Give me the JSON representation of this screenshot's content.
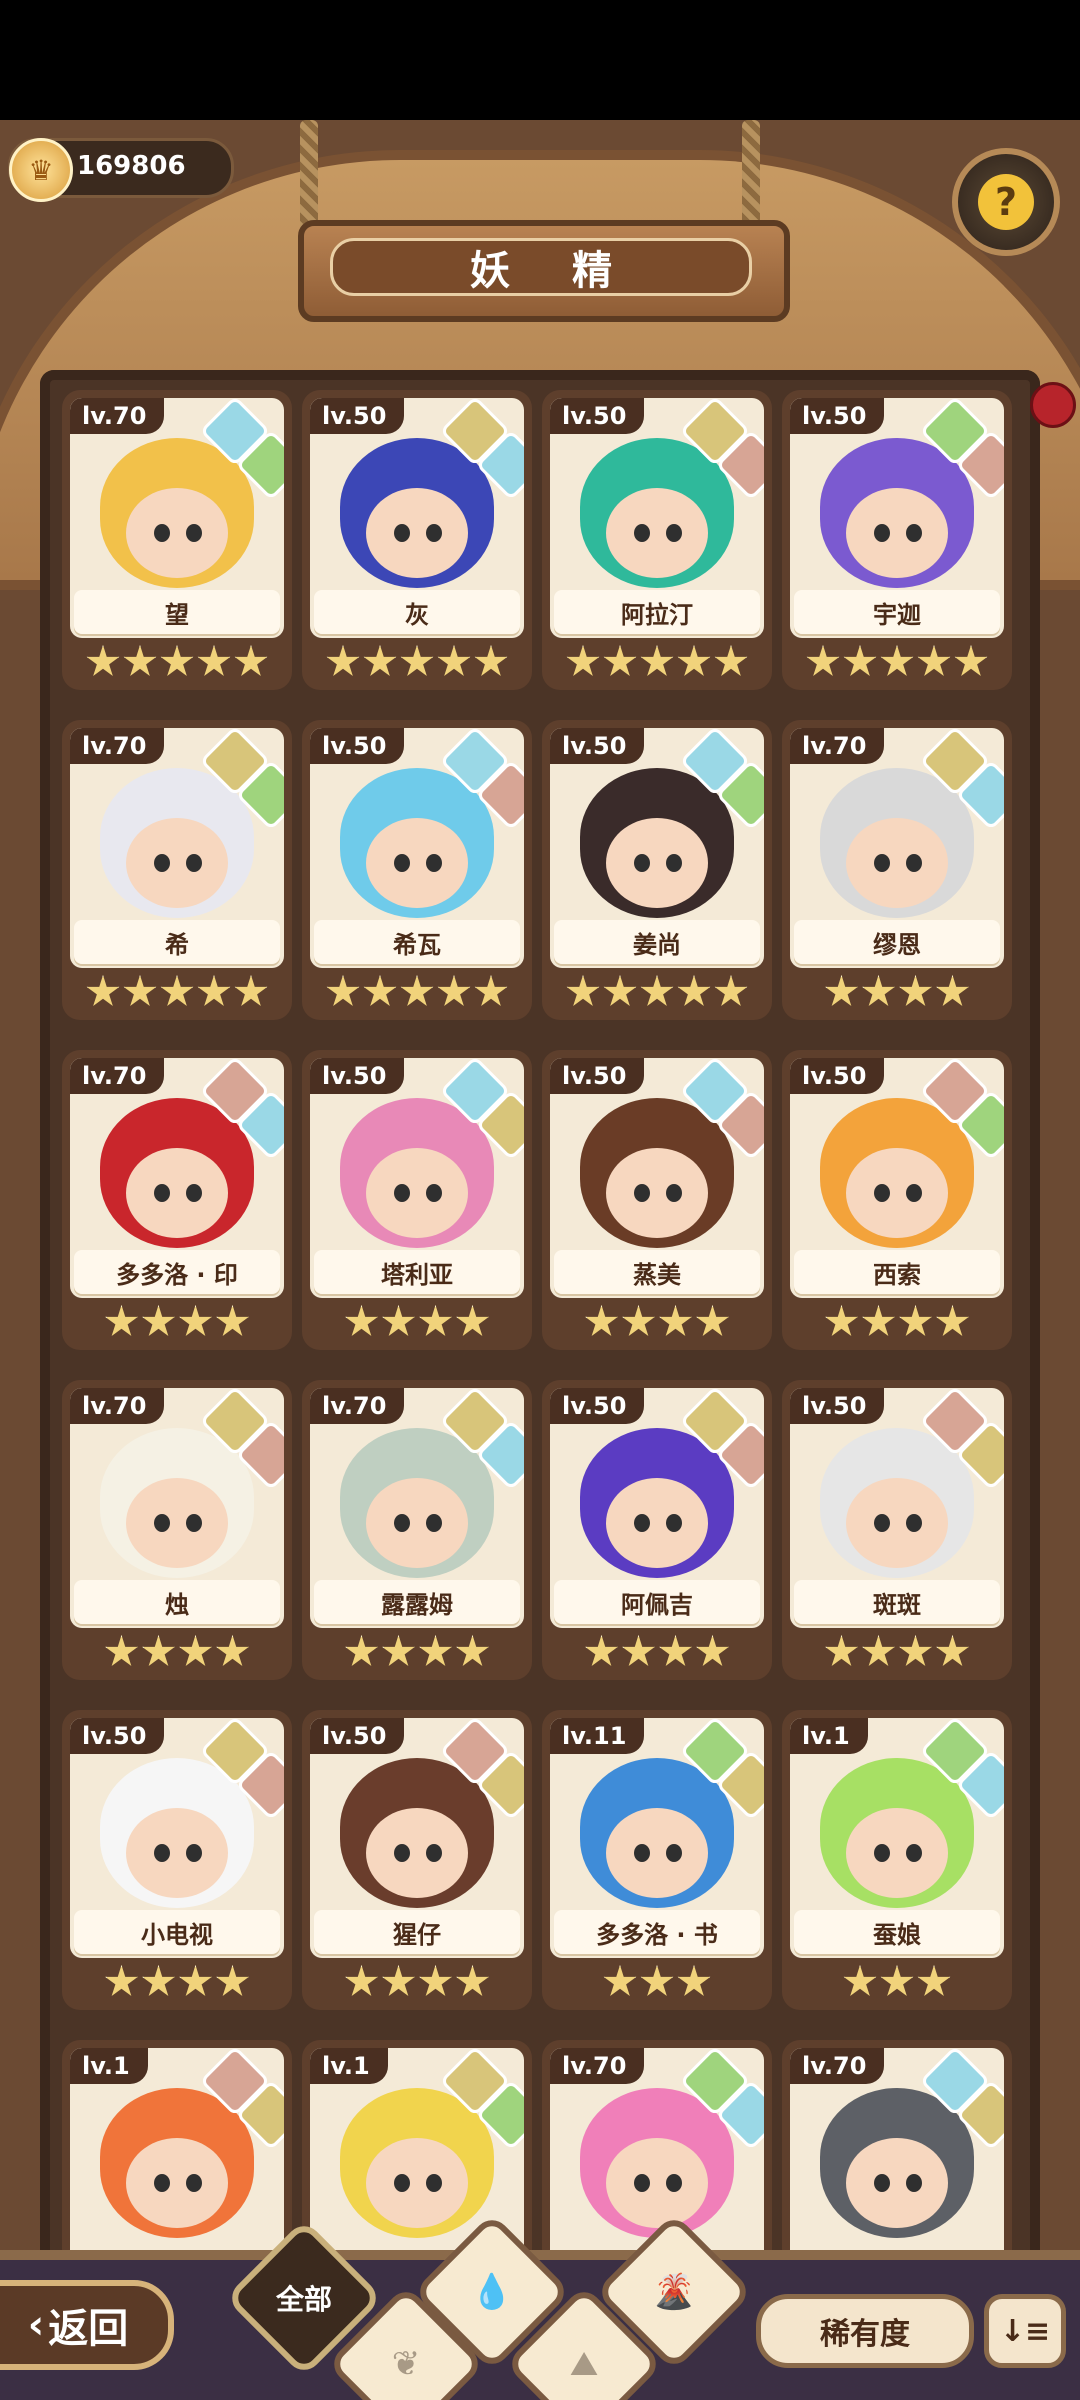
{
  "currency": {
    "value": "169806",
    "icon": "crown-coin-icon"
  },
  "header": {
    "title": "妖 精",
    "help_icon": "?"
  },
  "colors": {
    "water": "#9ad8e6",
    "leaf": "#9fd47d",
    "earth": "#d8c57a",
    "fire": "#d7a595"
  },
  "fairies": [
    {
      "level": "lv.70",
      "name": "望",
      "stars": 5,
      "elements": [
        "water",
        "leaf"
      ],
      "hair": "#f2c14a"
    },
    {
      "level": "lv.50",
      "name": "灰",
      "stars": 5,
      "elements": [
        "earth",
        "water"
      ],
      "hair": "#3c47b6"
    },
    {
      "level": "lv.50",
      "name": "阿拉汀",
      "stars": 5,
      "elements": [
        "earth",
        "fire"
      ],
      "hair": "#2fb99b"
    },
    {
      "level": "lv.50",
      "name": "宇迦",
      "stars": 5,
      "elements": [
        "leaf",
        "fire"
      ],
      "hair": "#7b5ad0"
    },
    {
      "level": "lv.70",
      "name": "希",
      "stars": 5,
      "elements": [
        "earth",
        "leaf"
      ],
      "hair": "#e8e8ef"
    },
    {
      "level": "lv.50",
      "name": "希瓦",
      "stars": 5,
      "elements": [
        "water",
        "fire"
      ],
      "hair": "#6fcbea"
    },
    {
      "level": "lv.50",
      "name": "姜尚",
      "stars": 5,
      "elements": [
        "water",
        "leaf"
      ],
      "hair": "#3a2b2a"
    },
    {
      "level": "lv.70",
      "name": "缪恩",
      "stars": 4,
      "elements": [
        "earth",
        "water"
      ],
      "hair": "#d9d9d9"
    },
    {
      "level": "lv.70",
      "name": "多多洛 · 印",
      "stars": 4,
      "elements": [
        "fire",
        "water"
      ],
      "hair": "#c9262c"
    },
    {
      "level": "lv.50",
      "name": "塔利亚",
      "stars": 4,
      "elements": [
        "water",
        "earth"
      ],
      "hair": "#e889b7"
    },
    {
      "level": "lv.50",
      "name": "蒸美",
      "stars": 4,
      "elements": [
        "water",
        "fire"
      ],
      "hair": "#6a3c26"
    },
    {
      "level": "lv.50",
      "name": "西索",
      "stars": 4,
      "elements": [
        "fire",
        "leaf"
      ],
      "hair": "#f3a33b"
    },
    {
      "level": "lv.70",
      "name": "烛",
      "stars": 4,
      "elements": [
        "earth",
        "fire"
      ],
      "hair": "#f5f1e4"
    },
    {
      "level": "lv.70",
      "name": "露露姆",
      "stars": 4,
      "elements": [
        "earth",
        "water"
      ],
      "hair": "#bfcfc1"
    },
    {
      "level": "lv.50",
      "name": "阿佩吉",
      "stars": 4,
      "elements": [
        "earth",
        "fire"
      ],
      "hair": "#5b3cc2"
    },
    {
      "level": "lv.50",
      "name": "斑斑",
      "stars": 4,
      "elements": [
        "fire",
        "earth"
      ],
      "hair": "#e6e6e6"
    },
    {
      "level": "lv.50",
      "name": "小电视",
      "stars": 4,
      "elements": [
        "earth",
        "fire"
      ],
      "hair": "#f6f6f6"
    },
    {
      "level": "lv.50",
      "name": "猩仔",
      "stars": 4,
      "elements": [
        "fire",
        "earth"
      ],
      "hair": "#6a3d2c"
    },
    {
      "level": "lv.11",
      "name": "多多洛 · 书",
      "stars": 3,
      "elements": [
        "leaf",
        "earth"
      ],
      "hair": "#3f8cd8"
    },
    {
      "level": "lv.1",
      "name": "蚕娘",
      "stars": 3,
      "elements": [
        "leaf",
        "water"
      ],
      "hair": "#a7e064"
    },
    {
      "level": "lv.1",
      "name": "",
      "stars": 0,
      "elements": [
        "fire",
        "earth"
      ],
      "hair": "#f0743a"
    },
    {
      "level": "lv.1",
      "name": "",
      "stars": 0,
      "elements": [
        "earth",
        "leaf"
      ],
      "hair": "#f1d44d"
    },
    {
      "level": "lv.70",
      "name": "",
      "stars": 0,
      "elements": [
        "leaf",
        "water"
      ],
      "hair": "#f07fb9"
    },
    {
      "level": "lv.70",
      "name": "",
      "stars": 0,
      "elements": [
        "water",
        "earth"
      ],
      "hair": "#5d6066"
    }
  ],
  "bottom": {
    "back_label": "返回",
    "filter_all": "全部",
    "sort_label": "稀有度",
    "order_label": "↓≡",
    "filters": [
      "all",
      "water",
      "leaf",
      "earth",
      "fire"
    ]
  }
}
